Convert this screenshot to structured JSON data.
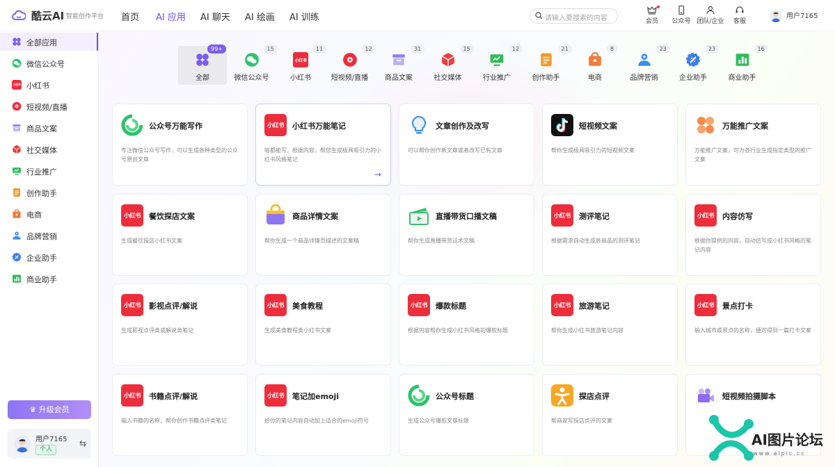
{
  "brand": {
    "name": "酷云AI",
    "subtitle": "智能创作平台"
  },
  "nav": [
    {
      "label": "首页"
    },
    {
      "label": "AI 应用"
    },
    {
      "label": "AI 聊天"
    },
    {
      "label": "AI 绘画"
    },
    {
      "label": "AI 训练"
    }
  ],
  "search": {
    "placeholder": "请输入要搜索的内容"
  },
  "utils": [
    {
      "label": "会员",
      "icon": "crown-icon"
    },
    {
      "label": "公众号",
      "icon": "phone-icon"
    },
    {
      "label": "团队/企业",
      "icon": "team-icon"
    },
    {
      "label": "客服",
      "icon": "headset-icon"
    }
  ],
  "user": {
    "name": "用户7165",
    "tag": "个人"
  },
  "sidebar": {
    "items": [
      {
        "label": "全部应用",
        "icon": "grid-icon",
        "color": "#7c5cf0"
      },
      {
        "label": "微信公众号",
        "icon": "wechat-icon",
        "color": "#2ec26a"
      },
      {
        "label": "小红书",
        "icon": "xhs-icon",
        "color": "#ee2d3c"
      },
      {
        "label": "短视频/直播",
        "icon": "video-icon",
        "color": "#ee2d3c"
      },
      {
        "label": "商品文案",
        "icon": "goods-icon",
        "color": "#8f7ef2"
      },
      {
        "label": "社交媒体",
        "icon": "cube-icon",
        "color": "#ee3b3b"
      },
      {
        "label": "行业推广",
        "icon": "monitor-icon",
        "color": "#2fbd5a"
      },
      {
        "label": "创作助手",
        "icon": "doc-icon",
        "color": "#f39a2b"
      },
      {
        "label": "电商",
        "icon": "shop-icon",
        "color": "#f37b3b"
      },
      {
        "label": "品牌营销",
        "icon": "people-icon",
        "color": "#3d8ef0"
      },
      {
        "label": "企业助手",
        "icon": "gear-icon",
        "color": "#3b7df0"
      },
      {
        "label": "商业助手",
        "icon": "chart-icon",
        "color": "#2fbd5a"
      }
    ],
    "upgrade": "升级会员"
  },
  "categories": [
    {
      "label": "全部",
      "count": "99+"
    },
    {
      "label": "微信公众号",
      "count": "15"
    },
    {
      "label": "小红书",
      "count": "11"
    },
    {
      "label": "短视频/直播",
      "count": "12"
    },
    {
      "label": "商品文案",
      "count": "31"
    },
    {
      "label": "社交媒体",
      "count": "15"
    },
    {
      "label": "行业推广",
      "count": "12"
    },
    {
      "label": "创作助手",
      "count": "21"
    },
    {
      "label": "电商",
      "count": "8"
    },
    {
      "label": "品牌营销",
      "count": "23"
    },
    {
      "label": "企业助手",
      "count": "23"
    },
    {
      "label": "商业助手",
      "count": "16"
    }
  ],
  "xhs_text": "小红书",
  "cards": [
    {
      "title": "公众号万能写作",
      "desc": "专注微信公众号写作，可以生成各种类型的公众号原创文章",
      "icon": "wechat-logo-icon"
    },
    {
      "title": "小红书万能笔记",
      "desc": "啥都能写，根据内容，帮您生成极具吸引力的小红书风格笔记",
      "icon": "xhs-icon"
    },
    {
      "title": "文章创作及改写",
      "desc": "可以帮你创作新文章或者改写已有文章",
      "icon": "bulb-icon"
    },
    {
      "title": "短视频文案",
      "desc": "帮你生成极具吸引力的短视频文案",
      "icon": "tiktok-icon"
    },
    {
      "title": "万能推广文案",
      "desc": "万能推广文案，可为各行业生成指定类型的推广文案",
      "icon": "grid-orange-icon"
    },
    {
      "title": "餐饮探店文案",
      "desc": "生成餐饮探店小红书文案",
      "icon": "xhs-icon"
    },
    {
      "title": "商品详情文案",
      "desc": "帮你生成一个商品详情页描述的文案稿",
      "icon": "bag-icon"
    },
    {
      "title": "直播带货口播文稿",
      "desc": "帮你生成直播带货话术文稿",
      "icon": "clapper-icon"
    },
    {
      "title": "测评笔记",
      "desc": "根据需求自动生成各商品的测评笔记",
      "icon": "xhs-icon"
    },
    {
      "title": "内容仿写",
      "desc": "根据你提供的内容，自动仿写成小红书风格的笔记内容",
      "icon": "xhs-icon"
    },
    {
      "title": "影视点评/解说",
      "desc": "生成影视点评类或解说类笔记",
      "icon": "xhs-icon"
    },
    {
      "title": "美食教程",
      "desc": "生成美食教程类小红书文案",
      "icon": "xhs-icon"
    },
    {
      "title": "爆款标题",
      "desc": "根据内容帮你生成小红书风格的爆款标题",
      "icon": "xhs-icon"
    },
    {
      "title": "旅游笔记",
      "desc": "帮你生成小红书旅游笔记内容",
      "icon": "xhs-icon"
    },
    {
      "title": "景点打卡",
      "desc": "输入城市或景点的名称，便可得到一篇打卡文案",
      "icon": "xhs-icon"
    },
    {
      "title": "书籍点评/解说",
      "desc": "输入书籍的名称，帮你创作书籍点评类笔记",
      "icon": "xhs-icon"
    },
    {
      "title": "笔记加emoji",
      "desc": "给你的笔记内容自动加上适合的emoji符号",
      "icon": "xhs-icon"
    },
    {
      "title": "公众号标题",
      "desc": "生成公众号爆款文章标题",
      "icon": "wechat-logo-icon"
    },
    {
      "title": "探店点评",
      "desc": "帮商家写探店点评的文案",
      "icon": "person-orange-icon"
    },
    {
      "title": "短视频拍摄脚本",
      "desc": "",
      "icon": "camera-icon"
    }
  ],
  "watermark": {
    "text": "AI图片论坛",
    "url": "www.aipic.cc"
  }
}
